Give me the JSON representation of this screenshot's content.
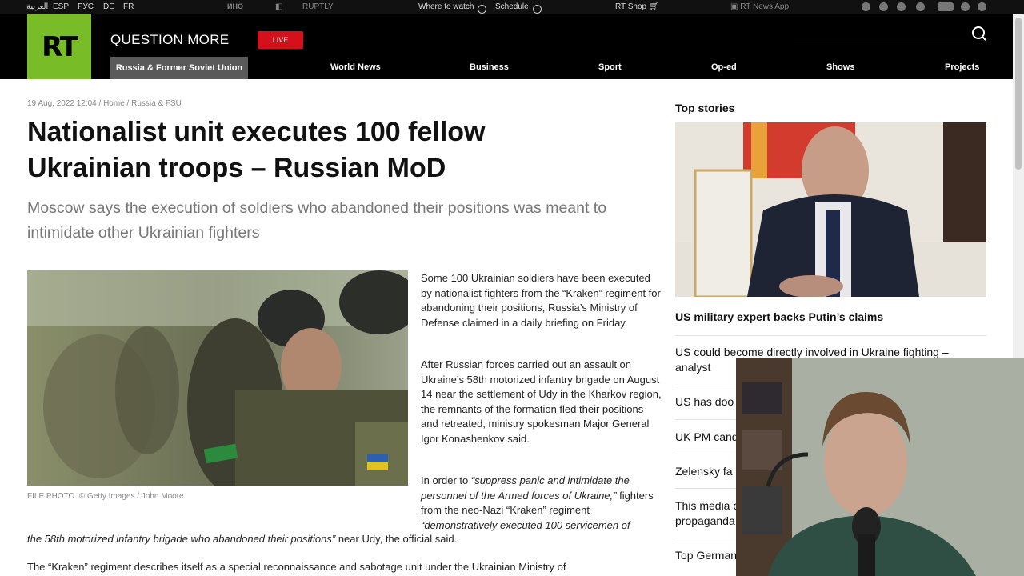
{
  "topbar": {
    "languages": [
      "العربية",
      "ESP",
      "РУС",
      "DE",
      "FR"
    ],
    "partners": [
      "ИНО",
      "RUPTLY"
    ],
    "where_to_watch": "Where to watch",
    "schedule": "Schedule",
    "shop": "RT Shop",
    "app": "RT News App"
  },
  "header": {
    "logo": "RT",
    "tagline": "QUESTION MORE",
    "live": "LIVE",
    "nav": [
      "Russia & Former Soviet Union",
      "World News",
      "Business",
      "Sport",
      "Op-ed",
      "Shows",
      "Projects"
    ]
  },
  "article": {
    "meta": "19 Aug, 2022 12:04 / Home / Russia & FSU",
    "headline_line1": "Nationalist unit executes 100 fellow",
    "headline_line2": "Ukrainian troops – Russian MoD",
    "subhead": "Moscow says the execution of soldiers who abandoned their positions was meant to intimidate other Ukrainian fighters",
    "caption": "FILE PHOTO. © Getty Images / John Moore",
    "p1": "Some 100 Ukrainian soldiers have been executed by nationalist fighters from the “Kraken” regiment for abandoning their positions, Russia’s Ministry of Defense claimed in a daily briefing on Friday.",
    "p2": "After Russian forces carried out an assault on Ukraine’s 58th motorized infantry brigade on August 14 near the settlement of Udy in the Kharkov region, the remnants of the formation fled their positions and retreated, ministry spokesman Major General Igor Konashenkov said.",
    "p3_a": "In order to ",
    "p3_q1": "“suppress panic and intimidate the personnel of the Armed forces of Ukraine,”",
    "p3_b": " fighters from the neo-Nazi “Kraken” regiment ",
    "p3_q2": "“demonstratively executed 100 servicemen of",
    "p3_q2_cont": "the 58th motorized infantry brigade who abandoned their positions”",
    "p3_end": " near Udy, the official said.",
    "p4": "The “Kraken” regiment describes itself as a special reconnaissance and sabotage unit under the Ukrainian Ministry of"
  },
  "sidebar": {
    "title": "Top stories",
    "lead": "US military expert backs Putin’s claims",
    "items": [
      "US could become directly involved in Ukraine fighting – analyst",
      "US has doo",
      "UK PM cand",
      "Zelensky fa",
      "This media c propaganda",
      "Top German"
    ]
  }
}
